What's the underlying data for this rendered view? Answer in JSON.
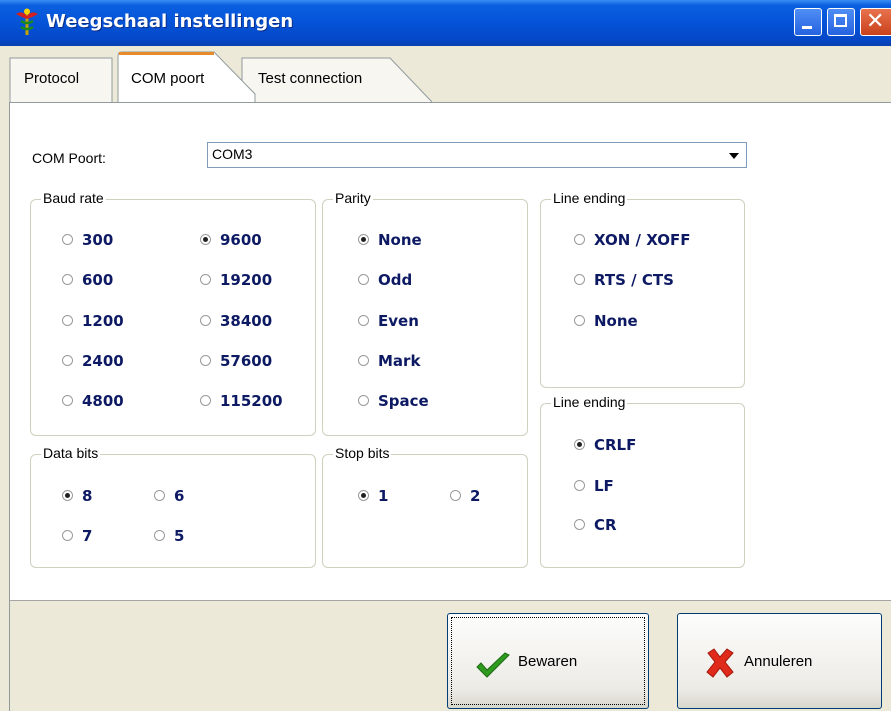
{
  "window": {
    "title": "Weegschaal instellingen"
  },
  "tabs": [
    {
      "label": "Protocol",
      "active": false
    },
    {
      "label": "COM poort",
      "active": true
    },
    {
      "label": "Test connection",
      "active": false
    }
  ],
  "com_port": {
    "label": "COM Poort:",
    "value": "COM3"
  },
  "baud_rate": {
    "title": "Baud rate",
    "options": [
      "300",
      "600",
      "1200",
      "2400",
      "4800",
      "9600",
      "19200",
      "38400",
      "57600",
      "115200"
    ],
    "selected": "9600"
  },
  "parity": {
    "title": "Parity",
    "options": [
      "None",
      "Odd",
      "Even",
      "Mark",
      "Space"
    ],
    "selected": "None"
  },
  "flow_control": {
    "title": "Line ending",
    "options": [
      "XON / XOFF",
      "RTS / CTS",
      "None"
    ],
    "selected": ""
  },
  "line_ending": {
    "title": "Line ending",
    "options": [
      "CRLF",
      "LF",
      "CR"
    ],
    "selected": "CRLF"
  },
  "data_bits": {
    "title": "Data bits",
    "options": [
      "8",
      "6",
      "7",
      "5"
    ],
    "selected": "8"
  },
  "stop_bits": {
    "title": "Stop bits",
    "options": [
      "1",
      "2"
    ],
    "selected": "1"
  },
  "buttons": {
    "save": "Bewaren",
    "cancel": "Annuleren"
  },
  "icons": {
    "app": "caduceus-icon",
    "save": "checkmark-icon",
    "cancel": "red-x-icon"
  }
}
